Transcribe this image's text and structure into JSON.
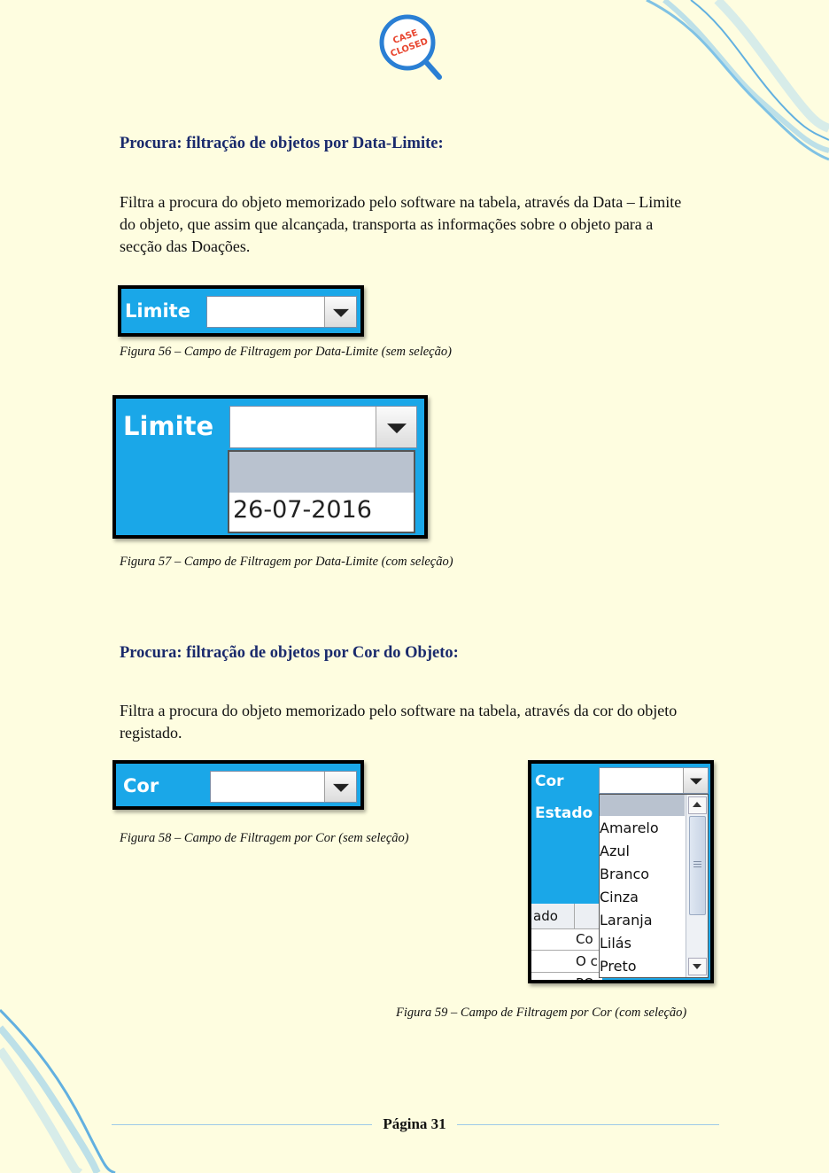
{
  "logo": {
    "text_line1": "CASE",
    "text_line2": "CLOSED"
  },
  "section1": {
    "heading": "Procura: filtração de objetos por Data-Limite:",
    "paragraph_lines": [
      "Filtra a procura do objeto memorizado pelo software na tabela, através da Data – Limite",
      "do objeto, que assim que alcançada, transporta as informações sobre o objeto para a",
      "secção das Doações."
    ]
  },
  "figure56": {
    "label": "Limite",
    "caption": "Figura 56 – Campo de Filtragem por Data-Limite (sem seleção)"
  },
  "figure57": {
    "label": "Limite",
    "option": "26-07-2016",
    "caption": "Figura 57 – Campo de Filtragem por Data-Limite (com seleção)"
  },
  "section2": {
    "heading": "Procura: filtração de objetos por Cor do Objeto:",
    "paragraph_lines": [
      "Filtra a procura do objeto memorizado pelo software na tabela, através da cor do objeto",
      "registado."
    ]
  },
  "figure58": {
    "label": "Cor",
    "caption": "Figura 58 – Campo de Filtragem por Cor (sem seleção)"
  },
  "figure59": {
    "label_cor": "Cor",
    "label_estado": "Estado",
    "table_header": "ado",
    "table_cells": [
      "Co",
      "O c",
      "PO"
    ],
    "options": [
      "Amarelo",
      "Azul",
      "Branco",
      "Cinza",
      "Laranja",
      "Lilás",
      "Preto"
    ],
    "caption": "Figura 59 – Campo de Filtragem por Cor (com seleção)"
  },
  "footer": {
    "page_label": "Página 31"
  },
  "colors": {
    "accent_blue": "#1aa7e8",
    "heading": "#1a2a6c",
    "background": "#fefde0"
  }
}
